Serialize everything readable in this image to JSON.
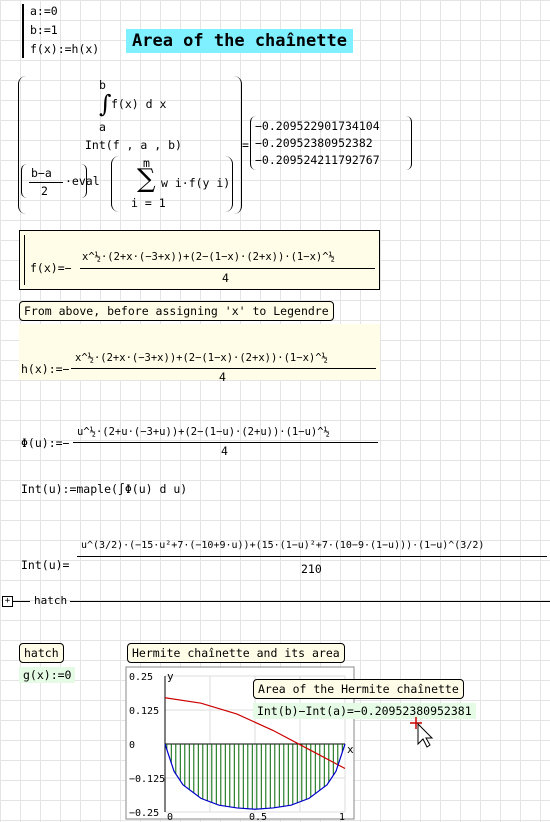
{
  "defs": {
    "a": "a:=0",
    "b": "b:=1",
    "f": "f(x):=h(x)"
  },
  "title": "Area of the chaînette",
  "integral": {
    "upper": "b",
    "lower": "a",
    "integrand": "f(x) d x",
    "int_call": "Int(f , a , b)",
    "frac_num": "b−a",
    "frac_den": "2",
    "eval": "·eval",
    "sum_upper": "m",
    "sum_lower": "i = 1",
    "sum_body": "w i·f(y i)",
    "equals": "=",
    "results": [
      "−0.209522901734104",
      "−0.20952380952382",
      "−0.209524211792767"
    ]
  },
  "f_expr": {
    "lhs": "f(x)=−",
    "num": "x^½·(2+x·(−3+x))+(2−(1−x)·(2+x))·(1−x)^½",
    "den": "4"
  },
  "note1": "From above, before assigning 'x' to Legendre",
  "h_expr": {
    "lhs": "h(x):=−",
    "num": "x^½·(2+x·(−3+x))+(2−(1−x)·(2+x))·(1−x)^½",
    "den": "4"
  },
  "phi_expr": {
    "lhs": "Φ(u):=−",
    "num": "u^½·(2+u·(−3+u))+(2−(1−u)·(2+u))·(1−u)^½",
    "den": "4"
  },
  "int_def": "Int(u):=maple(∫Φ(u) d u)",
  "int_expr": {
    "lhs": "Int(u)=",
    "num": "u^(3/2)·(−15·u²+7·(−10+9·u))+(15·(1−u)²+7·(10−9·(1−u)))·(1−u)^(3/2)",
    "den": "210"
  },
  "region_label": "hatch",
  "hatch_label": "hatch",
  "g_def": "g(x):=0",
  "plot_title": "Hermite chaînette and its area",
  "plot_area_title": "Area of the Hermite chaînette",
  "plot_result": "Int(b)−Int(a)=−0.20952380952381",
  "chart_data": {
    "type": "line",
    "ylabel": "y",
    "xlabel": "x",
    "yticks": [
      "0.25",
      "0.125",
      "0",
      "−0.125",
      "−0.25"
    ],
    "xticks": [
      "0",
      "0.5",
      "1"
    ],
    "xlim": [
      0,
      1
    ],
    "ylim": [
      -0.25,
      0.25
    ],
    "series": [
      {
        "color": "#cc0000",
        "x": [
          0,
          0.2,
          0.4,
          0.6,
          0.8,
          1.0
        ],
        "y": [
          0.17,
          0.15,
          0.11,
          0.05,
          -0.02,
          -0.09
        ]
      },
      {
        "color": "#0000cc",
        "x": [
          0,
          0.05,
          0.1,
          0.2,
          0.3,
          0.4,
          0.5,
          0.6,
          0.7,
          0.8,
          0.9,
          0.95,
          1
        ],
        "y": [
          0,
          -0.1,
          -0.15,
          -0.2,
          -0.225,
          -0.235,
          -0.24,
          -0.235,
          -0.225,
          -0.2,
          -0.15,
          -0.1,
          0
        ]
      }
    ],
    "hatch_color": "#006600"
  }
}
